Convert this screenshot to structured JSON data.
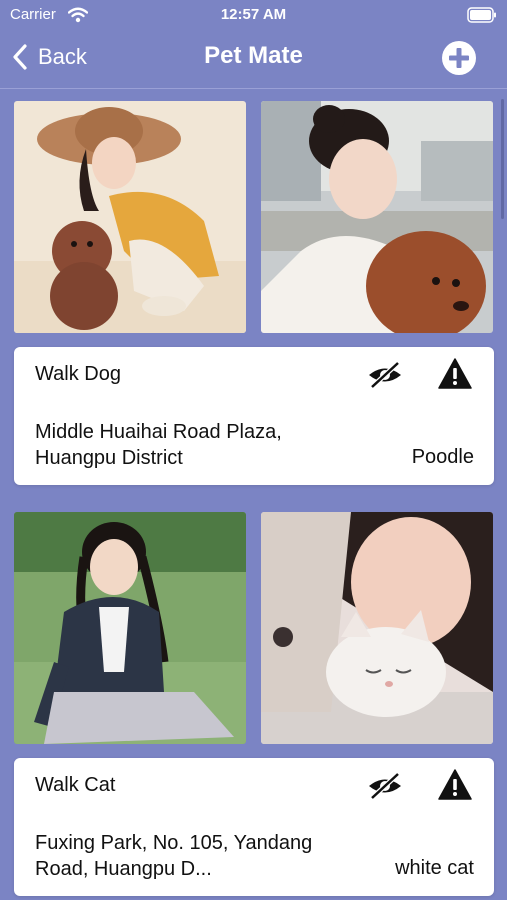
{
  "status_bar": {
    "carrier": "Carrier",
    "time": "12:57 AM"
  },
  "nav": {
    "back_label": "Back",
    "title": "Pet Mate"
  },
  "posts": [
    {
      "title": "Walk Dog",
      "address": "Middle Huaihai Road Plaza, Huangpu District",
      "pet_type": "Poodle"
    },
    {
      "title": "Walk Cat",
      "address": "Fuxing Park, No. 105, Yandang Road, Huangpu D...",
      "pet_type": "white cat"
    }
  ],
  "colors": {
    "background": "#7b84c4",
    "card": "#ffffff"
  }
}
